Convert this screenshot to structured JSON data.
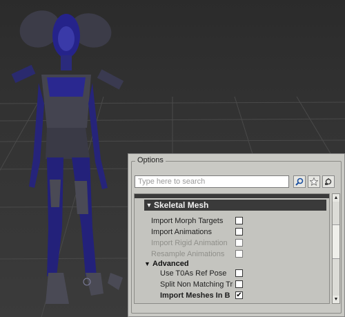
{
  "options": {
    "title": "Options",
    "search_placeholder": "Type here to search",
    "tool_icons": [
      "search-icon",
      "star-icon",
      "settings-icon"
    ],
    "section_title": "Skeletal Mesh",
    "rows": [
      {
        "label": "Import Morph Targets",
        "checked": false,
        "enabled": true
      },
      {
        "label": "Import Animations",
        "checked": false,
        "enabled": true
      },
      {
        "label": "Import Rigid Animation",
        "checked": false,
        "enabled": false
      },
      {
        "label": "Resample Animations",
        "checked": false,
        "enabled": false
      }
    ],
    "advanced_title": "Advanced",
    "advanced_rows": [
      {
        "label": "Use T0As Ref Pose",
        "checked": false,
        "enabled": true
      },
      {
        "label": "Split Non Matching Tri",
        "checked": false,
        "enabled": true
      },
      {
        "label": "Import Meshes In B",
        "checked": true,
        "enabled": true
      }
    ],
    "checkmark": "✔",
    "scroll_up": "▲",
    "scroll_down": "▼"
  }
}
